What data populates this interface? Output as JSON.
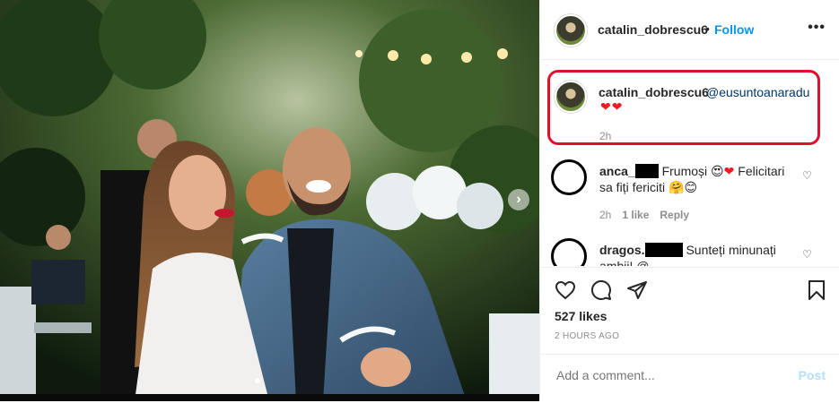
{
  "post": {
    "username": "catalin_dobrescu6",
    "separator": "•",
    "follow_label": "Follow",
    "more_label": "•••"
  },
  "caption": {
    "username": "catalin_dobrescu6",
    "mention": "@eusuntoanaradu",
    "hearts": "❤❤",
    "time": "2h"
  },
  "comments": [
    {
      "name": "anca_",
      "text_1": "Frumoși",
      "emoji_1": "😍",
      "heart": "❤",
      "text_2": "Felicitari",
      "line2": "sa fiți fericiti 🤗😊",
      "time": "2h",
      "likes": "1 like",
      "reply": "Reply"
    },
    {
      "name": "dragos.",
      "text_1": "Sunteți minunați",
      "line2": "ambii! @..."
    }
  ],
  "actions": {
    "likes": "527 likes",
    "ago": "2 HOURS AGO",
    "add_comment_placeholder": "Add a comment...",
    "post_label": "Post"
  },
  "colors": {
    "follow": "#0095f6",
    "highlight_box": "#e0102a",
    "post_disabled": "#b2dffc"
  }
}
